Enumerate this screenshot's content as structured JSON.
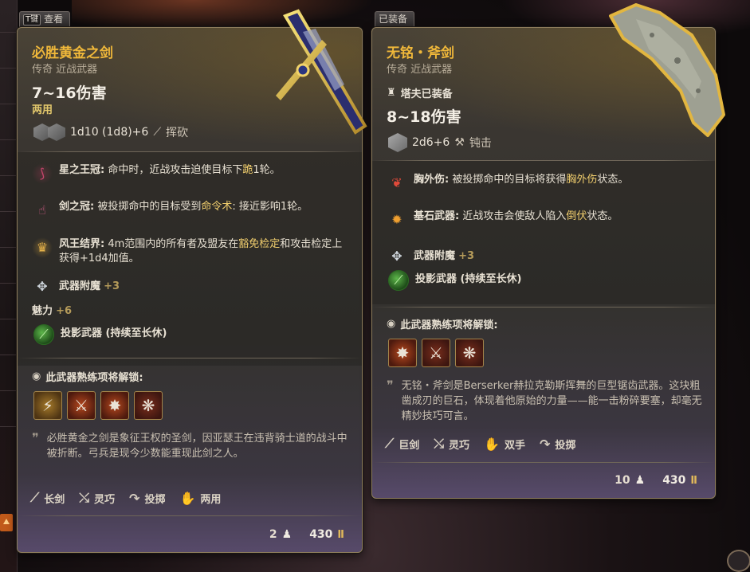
{
  "left_card": {
    "tab_key": "T键",
    "tab_label": "查看",
    "title": "必胜黄金之剑",
    "subtitle": "传奇 近战武器",
    "damage": "7~16伤害",
    "hands": "两用",
    "dice_text": "1d10 (1d8)+6",
    "attack_type": "挥砍",
    "features": [
      {
        "icon": "claw-icon",
        "name": "星之王冠:",
        "desc_a": " 命中时，近战攻击迫使目标下",
        "em": "跪",
        "desc_b": "1轮。"
      },
      {
        "icon": "hand-icon",
        "name": "剑之冠:",
        "desc_a": " 被投掷命中的目标受到",
        "em": "命令术",
        "desc_b": ": 接近影响1轮。"
      },
      {
        "icon": "crown-icon",
        "name": "风王结界:",
        "desc_a": " 4m范围内的所有者及盟友在",
        "em": "豁免检定",
        "desc_b": "和攻击检定上获得+1d4加值。"
      }
    ],
    "enchant_label": "武器附魔",
    "enchant_bonus": "+3",
    "charisma_label": "魅力",
    "charisma_bonus": "+6",
    "projected_label": "投影武器 (持续至长休)",
    "unlock_title": "此武器熟练项将解锁:",
    "lore": "必胜黄金之剑是象征王权的圣剑，因亚瑟王在违背骑士道的战斗中被折断。弓兵是现今少数能重现此剑之人。",
    "properties": [
      {
        "icon": "longsword-icon",
        "label": "长剑"
      },
      {
        "icon": "finesse-icon",
        "label": "灵巧"
      },
      {
        "icon": "thrown-icon",
        "label": "投掷"
      },
      {
        "icon": "versatile-icon",
        "label": "两用"
      }
    ],
    "weight": "2",
    "price": "430"
  },
  "right_card": {
    "tab_label": "已装备",
    "title": "无铭・斧剑",
    "subtitle": "传奇 近战武器",
    "equipped_by": "塔夫已装备",
    "damage": "8~18伤害",
    "dice_text": "2d6+6",
    "attack_type": "钝击",
    "features": [
      {
        "icon": "blood-drops-icon",
        "name": "胸外伤:",
        "desc_a": " 被投掷命中的目标将获得",
        "em": "胸外伤",
        "desc_b": "状态。"
      },
      {
        "icon": "burst-icon",
        "name": "基石武器:",
        "desc_a": " 近战攻击会使敌人陷入",
        "em": "倒伏",
        "desc_b": "状态。"
      }
    ],
    "enchant_label": "武器附魔",
    "enchant_bonus": "+3",
    "projected_label": "投影武器 (持续至长休)",
    "unlock_title": "此武器熟练项将解锁:",
    "lore": "无铭・斧剑是Berserker赫拉克勒斯挥舞的巨型锯齿武器。这块粗凿成刃的巨石，体现着他原始的力量——能一击粉碎要塞，却毫无精妙技巧可言。",
    "properties": [
      {
        "icon": "greatsword-icon",
        "label": "巨剑"
      },
      {
        "icon": "finesse-icon",
        "label": "灵巧"
      },
      {
        "icon": "two-handed-icon",
        "label": "双手"
      },
      {
        "icon": "thrown-icon",
        "label": "投掷"
      }
    ],
    "weight": "10",
    "price": "430"
  }
}
